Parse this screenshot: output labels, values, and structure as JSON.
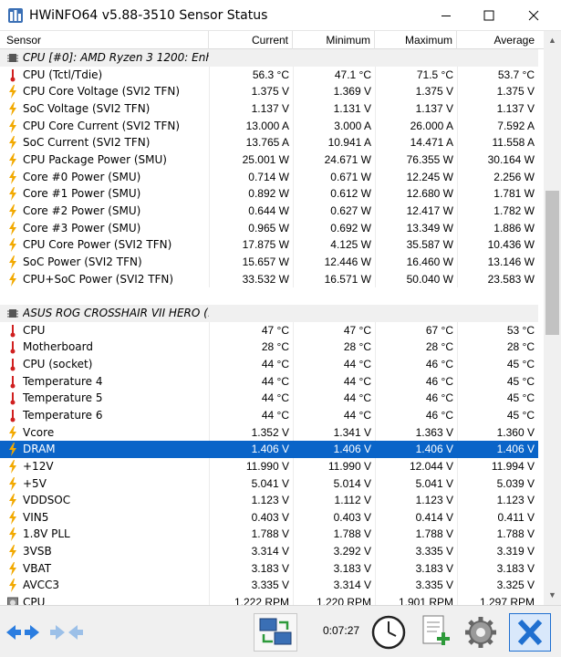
{
  "window": {
    "title": "HWiNFO64 v5.88-3510 Sensor Status"
  },
  "columns": {
    "sensor": "Sensor",
    "current": "Current",
    "minimum": "Minimum",
    "maximum": "Maximum",
    "average": "Average"
  },
  "rows": [
    {
      "type": "group",
      "label": "CPU [#0]: AMD Ryzen 3 1200: Enh...",
      "icon": "chip-icon"
    },
    {
      "type": "data",
      "label": "CPU (Tctl/Tdie)",
      "icon": "thermometer-icon",
      "cur": "56.3 °C",
      "min": "47.1 °C",
      "max": "71.5 °C",
      "avg": "53.7 °C"
    },
    {
      "type": "data",
      "label": "CPU Core Voltage (SVI2 TFN)",
      "icon": "lightning-icon",
      "cur": "1.375 V",
      "min": "1.369 V",
      "max": "1.375 V",
      "avg": "1.375 V"
    },
    {
      "type": "data",
      "label": "SoC Voltage (SVI2 TFN)",
      "icon": "lightning-icon",
      "cur": "1.137 V",
      "min": "1.131 V",
      "max": "1.137 V",
      "avg": "1.137 V"
    },
    {
      "type": "data",
      "label": "CPU Core Current (SVI2 TFN)",
      "icon": "lightning-icon",
      "cur": "13.000 A",
      "min": "3.000 A",
      "max": "26.000 A",
      "avg": "7.592 A"
    },
    {
      "type": "data",
      "label": "SoC Current (SVI2 TFN)",
      "icon": "lightning-icon",
      "cur": "13.765 A",
      "min": "10.941 A",
      "max": "14.471 A",
      "avg": "11.558 A"
    },
    {
      "type": "data",
      "label": "CPU Package Power (SMU)",
      "icon": "lightning-icon",
      "cur": "25.001 W",
      "min": "24.671 W",
      "max": "76.355 W",
      "avg": "30.164 W"
    },
    {
      "type": "data",
      "label": "Core #0 Power (SMU)",
      "icon": "lightning-icon",
      "cur": "0.714 W",
      "min": "0.671 W",
      "max": "12.245 W",
      "avg": "2.256 W"
    },
    {
      "type": "data",
      "label": "Core #1 Power (SMU)",
      "icon": "lightning-icon",
      "cur": "0.892 W",
      "min": "0.612 W",
      "max": "12.680 W",
      "avg": "1.781 W"
    },
    {
      "type": "data",
      "label": "Core #2 Power (SMU)",
      "icon": "lightning-icon",
      "cur": "0.644 W",
      "min": "0.627 W",
      "max": "12.417 W",
      "avg": "1.782 W"
    },
    {
      "type": "data",
      "label": "Core #3 Power (SMU)",
      "icon": "lightning-icon",
      "cur": "0.965 W",
      "min": "0.692 W",
      "max": "13.349 W",
      "avg": "1.886 W"
    },
    {
      "type": "data",
      "label": "CPU Core Power (SVI2 TFN)",
      "icon": "lightning-icon",
      "cur": "17.875 W",
      "min": "4.125 W",
      "max": "35.587 W",
      "avg": "10.436 W"
    },
    {
      "type": "data",
      "label": "SoC Power (SVI2 TFN)",
      "icon": "lightning-icon",
      "cur": "15.657 W",
      "min": "12.446 W",
      "max": "16.460 W",
      "avg": "13.146 W"
    },
    {
      "type": "data",
      "label": "CPU+SoC Power (SVI2 TFN)",
      "icon": "lightning-icon",
      "cur": "33.532 W",
      "min": "16.571 W",
      "max": "50.040 W",
      "avg": "23.583 W"
    },
    {
      "type": "blank"
    },
    {
      "type": "group",
      "label": "ASUS ROG CROSSHAIR VII HERO (...",
      "icon": "chip-icon"
    },
    {
      "type": "data",
      "label": "CPU",
      "icon": "thermometer-icon",
      "cur": "47 °C",
      "min": "47 °C",
      "max": "67 °C",
      "avg": "53 °C"
    },
    {
      "type": "data",
      "label": "Motherboard",
      "icon": "thermometer-icon",
      "cur": "28 °C",
      "min": "28 °C",
      "max": "28 °C",
      "avg": "28 °C"
    },
    {
      "type": "data",
      "label": "CPU (socket)",
      "icon": "thermometer-icon",
      "cur": "44 °C",
      "min": "44 °C",
      "max": "46 °C",
      "avg": "45 °C"
    },
    {
      "type": "data",
      "label": "Temperature 4",
      "icon": "thermometer-icon",
      "cur": "44 °C",
      "min": "44 °C",
      "max": "46 °C",
      "avg": "45 °C"
    },
    {
      "type": "data",
      "label": "Temperature 5",
      "icon": "thermometer-icon",
      "cur": "44 °C",
      "min": "44 °C",
      "max": "46 °C",
      "avg": "45 °C"
    },
    {
      "type": "data",
      "label": "Temperature 6",
      "icon": "thermometer-icon",
      "cur": "44 °C",
      "min": "44 °C",
      "max": "46 °C",
      "avg": "45 °C"
    },
    {
      "type": "data",
      "label": "Vcore",
      "icon": "lightning-icon",
      "cur": "1.352 V",
      "min": "1.341 V",
      "max": "1.363 V",
      "avg": "1.360 V"
    },
    {
      "type": "data",
      "label": "DRAM",
      "icon": "lightning-icon",
      "cur": "1.406 V",
      "min": "1.406 V",
      "max": "1.406 V",
      "avg": "1.406 V",
      "selected": true
    },
    {
      "type": "data",
      "label": "+12V",
      "icon": "lightning-icon",
      "cur": "11.990 V",
      "min": "11.990 V",
      "max": "12.044 V",
      "avg": "11.994 V"
    },
    {
      "type": "data",
      "label": "+5V",
      "icon": "lightning-icon",
      "cur": "5.041 V",
      "min": "5.014 V",
      "max": "5.041 V",
      "avg": "5.039 V"
    },
    {
      "type": "data",
      "label": "VDDSOC",
      "icon": "lightning-icon",
      "cur": "1.123 V",
      "min": "1.112 V",
      "max": "1.123 V",
      "avg": "1.123 V"
    },
    {
      "type": "data",
      "label": "VIN5",
      "icon": "lightning-icon",
      "cur": "0.403 V",
      "min": "0.403 V",
      "max": "0.414 V",
      "avg": "0.411 V"
    },
    {
      "type": "data",
      "label": "1.8V PLL",
      "icon": "lightning-icon",
      "cur": "1.788 V",
      "min": "1.788 V",
      "max": "1.788 V",
      "avg": "1.788 V"
    },
    {
      "type": "data",
      "label": "3VSB",
      "icon": "lightning-icon",
      "cur": "3.314 V",
      "min": "3.292 V",
      "max": "3.335 V",
      "avg": "3.319 V"
    },
    {
      "type": "data",
      "label": "VBAT",
      "icon": "lightning-icon",
      "cur": "3.183 V",
      "min": "3.183 V",
      "max": "3.183 V",
      "avg": "3.183 V"
    },
    {
      "type": "data",
      "label": "AVCC3",
      "icon": "lightning-icon",
      "cur": "3.335 V",
      "min": "3.314 V",
      "max": "3.335 V",
      "avg": "3.325 V"
    },
    {
      "type": "data",
      "label": "CPU",
      "icon": "fan-icon",
      "cur": "1,222 RPM",
      "min": "1,220 RPM",
      "max": "1,901 RPM",
      "avg": "1,297 RPM"
    }
  ],
  "toolbar": {
    "timer": "0:07:27",
    "buttons": [
      "nav-arrows-button",
      "nav-arrows-disabled-button",
      "network-button",
      "clock-button",
      "add-report-button",
      "settings-button",
      "close-sensors-button"
    ]
  },
  "colors": {
    "selection": "#0a64c8",
    "group_bg": "#f0f0f0",
    "thermo": "#d02020",
    "bolt": "#f2a900",
    "close_btn": "#1f6fd0"
  }
}
